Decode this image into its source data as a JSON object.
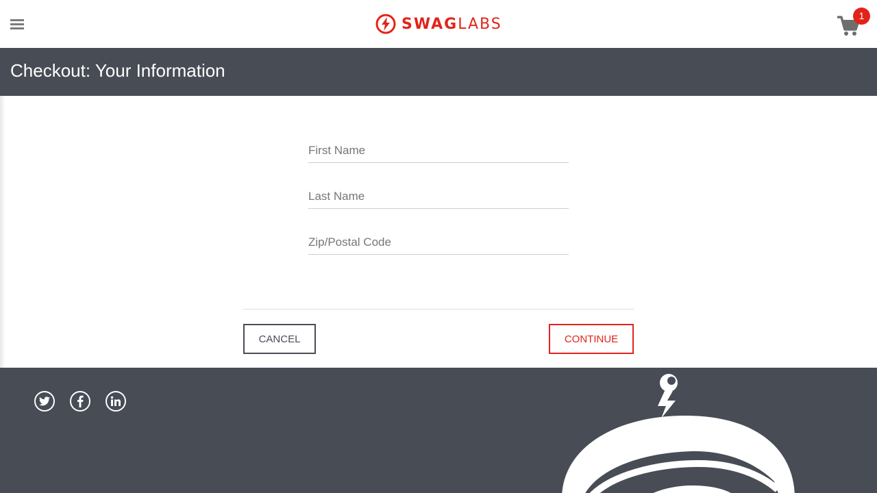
{
  "app": {
    "brand_word1": "SWAG",
    "brand_word2": "LABS",
    "accent_color": "#e2231a",
    "dark_color": "#474c55"
  },
  "header": {
    "menu_icon": "hamburger-menu-icon",
    "cart_icon": "shopping-cart-icon",
    "cart_count": "1"
  },
  "page": {
    "title": "Checkout: Your Information"
  },
  "form": {
    "first_name_placeholder": "First Name",
    "last_name_placeholder": "Last Name",
    "postal_code_placeholder": "Zip/Postal Code",
    "first_name_value": "",
    "last_name_value": "",
    "postal_code_value": ""
  },
  "actions": {
    "cancel_label": "CANCEL",
    "continue_label": "CONTINUE"
  },
  "footer": {
    "social_icons": [
      "twitter-icon",
      "facebook-icon",
      "linkedin-icon"
    ]
  }
}
